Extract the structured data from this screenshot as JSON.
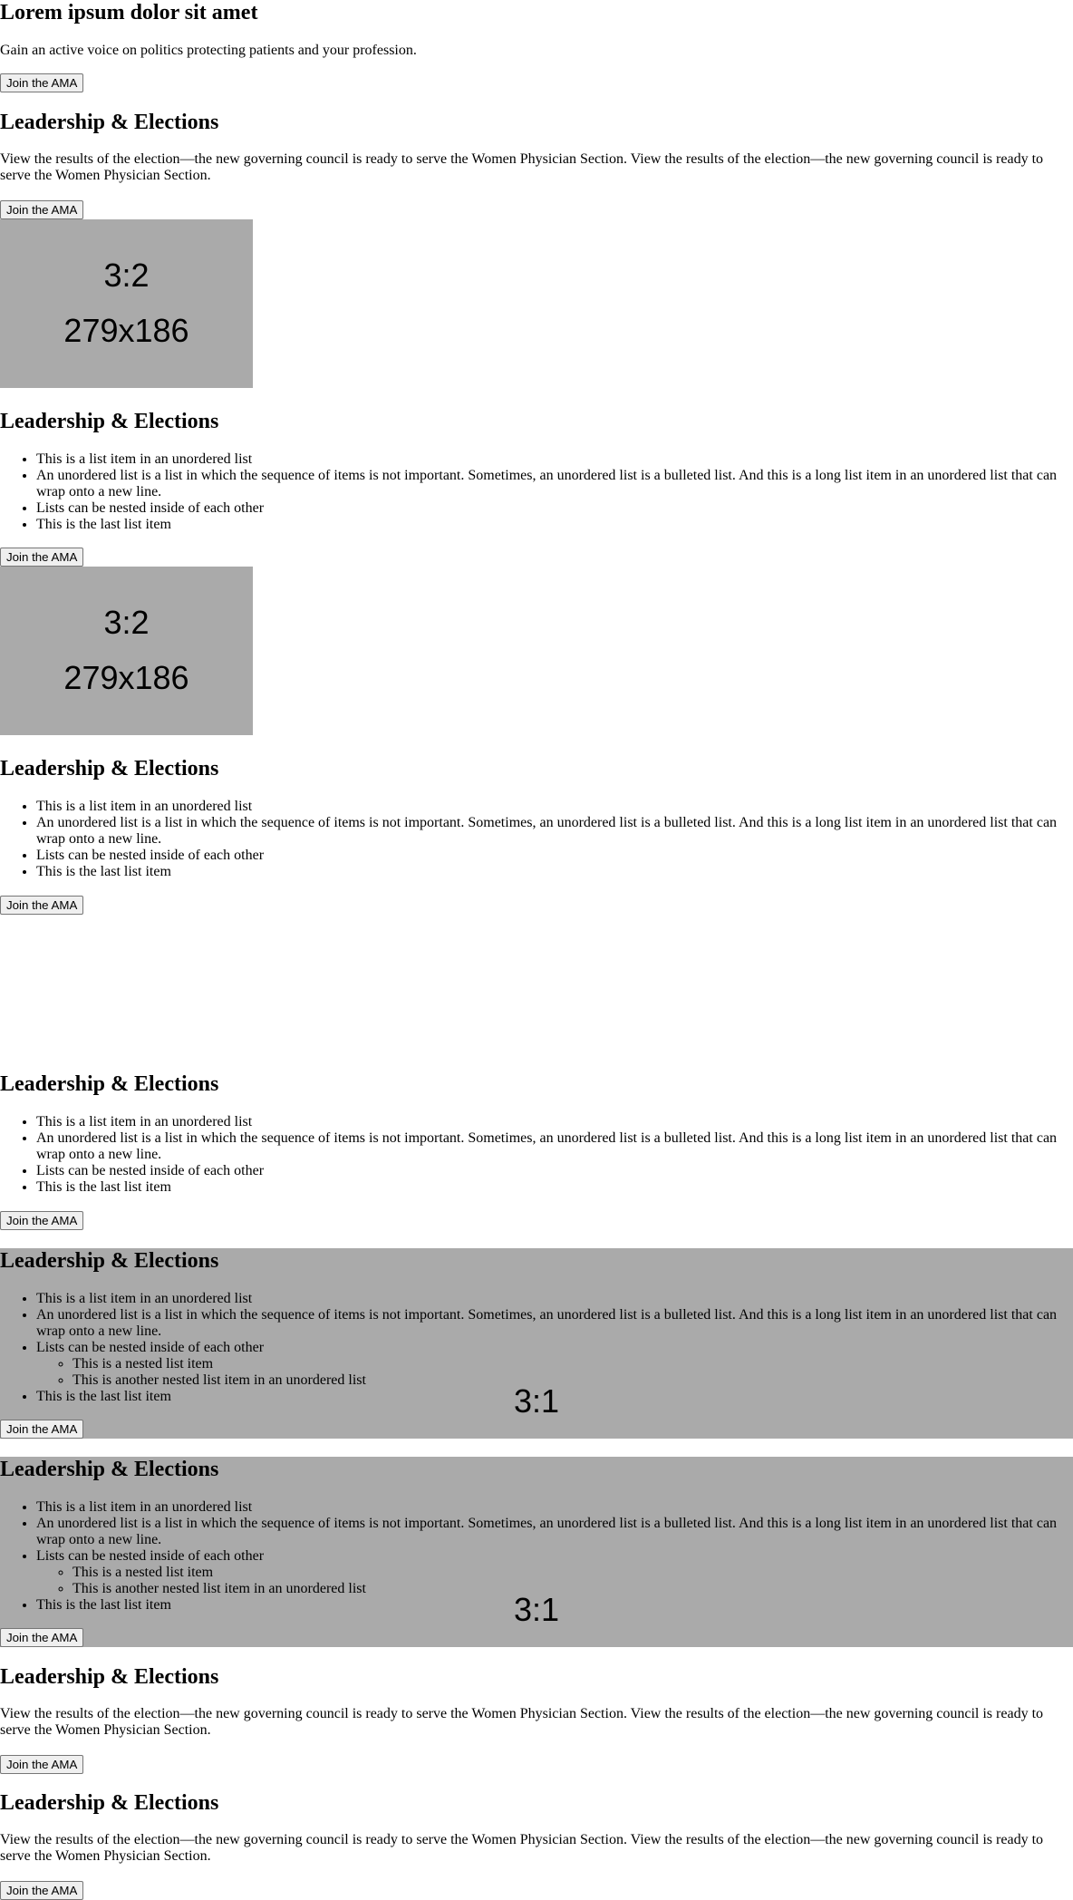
{
  "hero": {
    "title": "Lorem ipsum dolor sit amet",
    "text": "Gain an active voice on politics protecting patients and your profession.",
    "button": "Join the AMA"
  },
  "heading": "Leadership & Elections",
  "button_label": "Join the AMA",
  "paragraph": "View the results of the election—the new governing council is ready to serve the Women Physician Section. View the results of the election—the new governing council is ready to serve the Women Physician Section.",
  "list_items": [
    "This is a list item in an unordered list",
    "An unordered list is a list in which the sequence of items is not important. Sometimes, an unordered list is a bulleted list. And this is a long list item in an unordered list that can wrap onto a new line.",
    "Lists can be nested inside of each other",
    "This is the last list item"
  ],
  "nested_items": [
    "This is a nested list item",
    "This is another nested list item in an unordered list"
  ],
  "placeholder_small": {
    "ratio": "3:2",
    "dims": "279x186"
  },
  "placeholder_wide": {
    "ratio": "3:1"
  },
  "colors": {
    "placeholder_bg": "#aaaaaa",
    "page_bg": "#ffffff",
    "button_bg": "#efefef",
    "button_border": "#767676"
  }
}
